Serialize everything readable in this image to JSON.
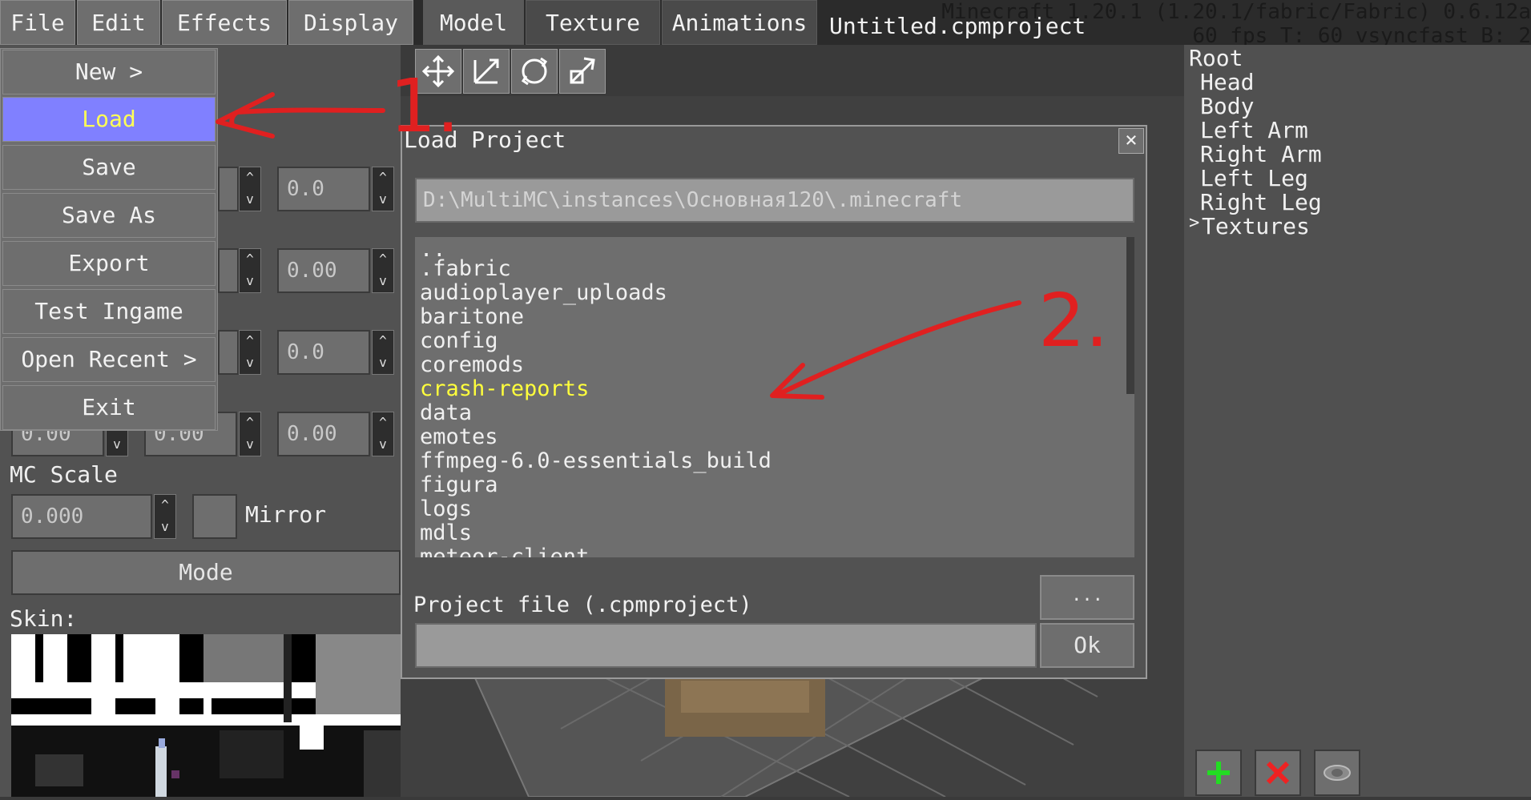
{
  "menubar": {
    "file": "File",
    "edit": "Edit",
    "effects": "Effects",
    "display": "Display",
    "tabs": [
      "Model",
      "Texture",
      "Animations"
    ],
    "project_title": "Untitled.cpmproject",
    "debug_line1": "Minecraft 1.20.1 (1.20.1/fabric/Fabric) 0.6.12a",
    "debug_line2": "60 fps T: 60 vsyncfast B: 2"
  },
  "file_menu": {
    "items": [
      "New >",
      "Load",
      "Save",
      "Save As",
      "Export",
      "Test Ingame",
      "Open Recent >",
      "Exit"
    ],
    "highlighted": "Load"
  },
  "left_panel": {
    "values": [
      "0.0",
      "0.00",
      "0.0",
      "0.00",
      "0.00",
      "0.00"
    ],
    "mc_scale_label": "MC Scale",
    "mc_scale_value": "0.000",
    "mirror_label": "Mirror",
    "mode_label": "Mode",
    "skin_label": "Skin:"
  },
  "tool_icons": [
    "move-icon",
    "scale-icon",
    "rotate-icon",
    "size-icon"
  ],
  "model_tree": {
    "root": "Root",
    "items": [
      "Head",
      "Body",
      "Left Arm",
      "Right Arm",
      "Left Leg",
      "Right Leg"
    ],
    "textures": "Textures",
    "textures_marker": ">"
  },
  "dialog": {
    "title": "Load Project",
    "close": "×",
    "path": "D:\\MultiMC\\instances\\Основная120\\.minecraft",
    "files": [
      "..",
      ".fabric",
      "audioplayer_uploads",
      "baritone",
      "config",
      "coremods",
      "crash-reports",
      "data",
      "emotes",
      "ffmpeg-6.0-essentials_build",
      "figura",
      "logs",
      "mdls",
      "meteor-client"
    ],
    "selected_file": "crash-reports",
    "file_label": "Project file (.cpmproject)",
    "file_value": "",
    "browse_label": "...",
    "ok_label": "Ok"
  },
  "annotations": {
    "step1": "1.",
    "step2": "2."
  },
  "colors": {
    "highlight_bg": "#8080ff",
    "highlight_text": "#ffff55",
    "selected_file": "#ffff3c",
    "annotation": "#e02020"
  }
}
